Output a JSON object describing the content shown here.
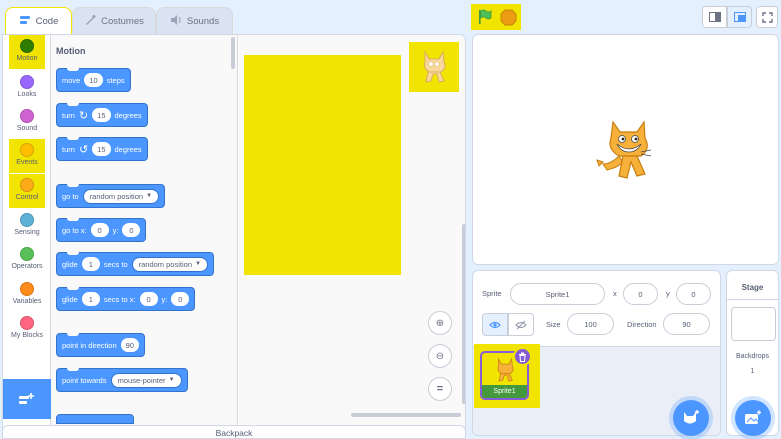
{
  "tabs": [
    {
      "label": "Code",
      "icon": "code-icon"
    },
    {
      "label": "Costumes",
      "icon": "brush-icon"
    },
    {
      "label": "Sounds",
      "icon": "speaker-icon"
    }
  ],
  "categories": [
    {
      "label": "Motion",
      "color": "#4c97ff",
      "dot": "#2e7d00"
    },
    {
      "label": "Looks",
      "color": "#9966ff",
      "dot": "#9966ff"
    },
    {
      "label": "Sound",
      "color": "#cf63cf",
      "dot": "#cf63cf"
    },
    {
      "label": "Events",
      "color": "#ffbf00",
      "dot": "#ffbf00"
    },
    {
      "label": "Control",
      "color": "#ffab19",
      "dot": "#ffab19"
    },
    {
      "label": "Sensing",
      "color": "#5cb1d6",
      "dot": "#5cb1d6"
    },
    {
      "label": "Operators",
      "color": "#59c059",
      "dot": "#59c059"
    },
    {
      "label": "Variables",
      "color": "#ff8c1a",
      "dot": "#ff8c1a"
    },
    {
      "label": "My Blocks",
      "color": "#ff6680",
      "dot": "#ff6680"
    }
  ],
  "palette": {
    "heading": "Motion",
    "move": {
      "a": "move",
      "n": "10",
      "b": "steps"
    },
    "turn_right": {
      "a": "turn",
      "n": "15",
      "b": "degrees"
    },
    "turn_left": {
      "a": "turn",
      "n": "15",
      "b": "degrees"
    },
    "goto": {
      "a": "go to",
      "opt": "random position"
    },
    "goto_xy": {
      "a": "go to x:",
      "x": "0",
      "b": "y:",
      "y": "0"
    },
    "glide": {
      "a": "glide",
      "n": "1",
      "b": "secs to",
      "opt": "random position"
    },
    "glide_xy": {
      "a": "glide",
      "n": "1",
      "b": "secs to x:",
      "x": "0",
      "c": "y:",
      "y": "0"
    },
    "point_dir": {
      "a": "point in direction",
      "n": "90"
    },
    "point_towards": {
      "a": "point towards",
      "opt": "mouse-pointer"
    }
  },
  "backpack": "Backpack",
  "zoom": {
    "in": "+",
    "out": "−",
    "reset": "="
  },
  "sprite_info": {
    "sprite_label": "Sprite",
    "sprite_name": "Sprite1",
    "x_label": "x",
    "x": "0",
    "y_label": "y",
    "y": "0",
    "size_label": "Size",
    "size": "100",
    "direction_label": "Direction",
    "direction": "90"
  },
  "sprite_tile": {
    "name": "Sprite1"
  },
  "stage_panel": {
    "title": "Stage",
    "backdrops_label": "Backdrops",
    "backdrops_count": "1"
  },
  "colors": {
    "highlight": "#f0e400",
    "motion": "#4c97ff",
    "selected": "#855cd6"
  }
}
